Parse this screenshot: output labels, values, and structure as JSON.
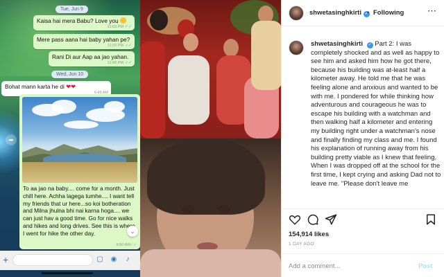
{
  "whatsapp": {
    "date1": "Tue, Jun 9",
    "date2": "Wed, Jun 10",
    "messages": [
      {
        "text": "Kaisa hai mera Babu? Love you",
        "time": "11:03 PM"
      },
      {
        "text": "Mere pass aana hai baby yahan pe?",
        "time": "11:03 PM"
      },
      {
        "text": "Rani Di aur Aap aa jao yahan.",
        "time": "11:06 PM"
      },
      {
        "text": "Bohat mann karta he di",
        "time": "6:49 AM"
      }
    ],
    "media_caption": "To aa jao na baby.... come for a month. Just chill here. Achha lagega tumhe.... I want tell my friends that ur here...so koi botheration and Milna jhulna bhi nai karna hoga.... we can just hav a good time. Go for nice walks and hikes and long drives. See this is where I went for hike the other day.",
    "media_time": "6:50 AM",
    "icons": [
      "forward-icon",
      "chevron-down-icon",
      "plus-icon",
      "sticker-icon",
      "camera-icon",
      "microphone-icon"
    ]
  },
  "instagram": {
    "username": "shwetasinghkirti",
    "follow_status": "Following",
    "separator": "•",
    "caption_username": "shwetasinghkirti",
    "caption_text": "Part 2: I was completely shocked and as well as happy to see him and asked him how he got there, because his building was at-least half a kilometer away. He told me that he was feeling alone and anxious and wanted to be with me. I pondered for while thinking how adventurous and courageous he was to escape his building with a watchman and then walking half a kilometer and entering my building right under a watchman's nose and finally finding my class and me. I found his explanation of running away from his building pretty viable as I knew that feeling, When I was dropped off at the school for the first time, I kept crying and asking Dad not to leave me. \"Please don't leave me",
    "likes": "154,914 likes",
    "time_ago": "1 DAY AGO",
    "comment_placeholder": "Add a comment...",
    "post_label": "Post",
    "icons": [
      "verified-icon",
      "more-icon",
      "heart-icon",
      "comment-icon",
      "share-icon",
      "bookmark-icon"
    ],
    "colors": {
      "verified": "#3897f0",
      "post_disabled": "#b2dffc"
    }
  },
  "photos": [
    "wedding-photo",
    "childhood-photo"
  ]
}
